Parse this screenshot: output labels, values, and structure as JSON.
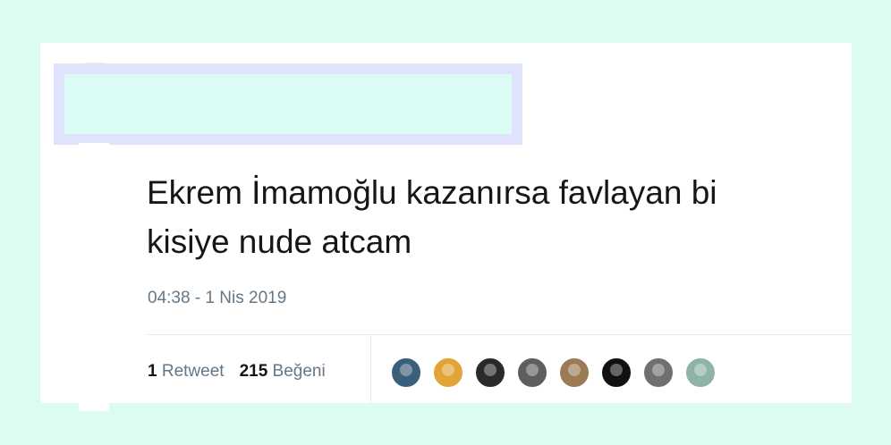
{
  "tweet": {
    "text_line1": "Ekrem İmamoğlu kazanırsa favlayan bi",
    "text_line2": "kisiye nude atcam",
    "timestamp": "04:38 - 1 Nis 2019"
  },
  "stats": {
    "retweet_count": "1",
    "retweet_label": "Retweet",
    "like_count": "215",
    "like_label": "Beğeni"
  },
  "likers": [
    {
      "icon": "liker-avatar",
      "color": "#3a5f7a"
    },
    {
      "icon": "liker-avatar",
      "color": "#e0a437"
    },
    {
      "icon": "liker-avatar",
      "color": "#2a2a2a"
    },
    {
      "icon": "liker-avatar",
      "color": "#5e5e5e"
    },
    {
      "icon": "liker-avatar",
      "color": "#9b7a55"
    },
    {
      "icon": "liker-avatar",
      "color": "#111111"
    },
    {
      "icon": "liker-avatar",
      "color": "#707070"
    },
    {
      "icon": "liker-avatar",
      "color": "#8fb3a9"
    }
  ],
  "colors": {
    "background": "#dcfbf3",
    "card": "#ffffff",
    "text": "#14171a",
    "secondary": "#657786"
  }
}
